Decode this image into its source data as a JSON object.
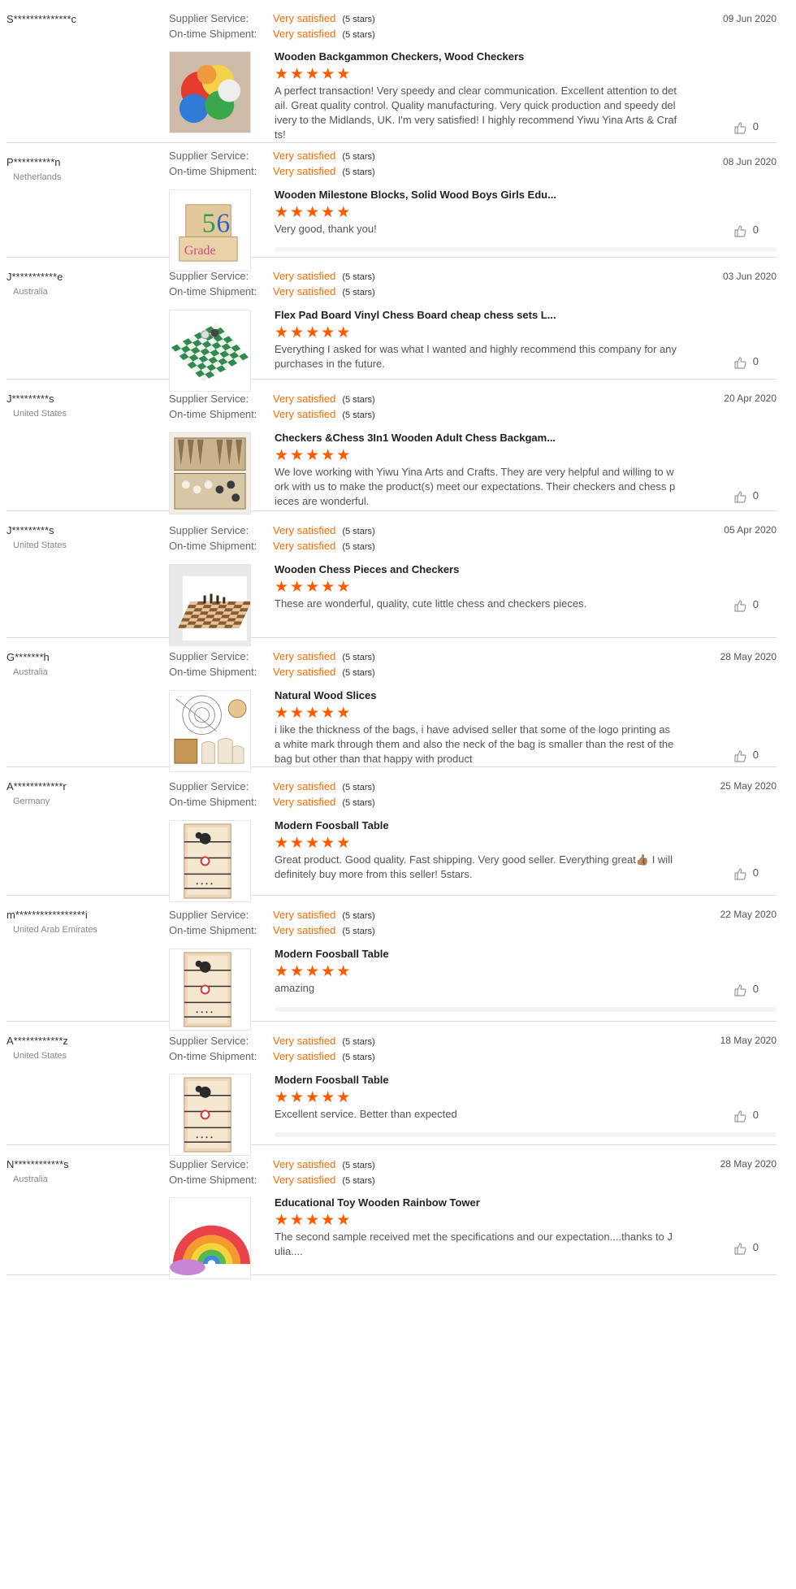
{
  "labels": {
    "supplier_service": "Supplier Service:",
    "ontime_shipment": "On-time Shipment:",
    "very_satisfied": "Very satisfied",
    "five_stars": "(5 stars)"
  },
  "colors": {
    "accent": "#ff6a00",
    "star": "#ff5a00"
  },
  "reviews": [
    {
      "buyer": "S**************c",
      "country": "",
      "date": "09 Jun 2020",
      "product": "Wooden Backgammon Checkers, Wood Checkers",
      "rating": 5,
      "comment": "A perfect transaction! Very speedy and clear communication. Excellent attention to detail. Great quality control. Quality manufacturing. Very quick production and speedy delivery to the Midlands, UK. I'm very satisfied! I highly recommend Yiwu Yina Arts & Crafts!",
      "likes": "0",
      "thumb_icon": "colored-checkers-image"
    },
    {
      "buyer": "P**********n",
      "country": "Netherlands",
      "date": "08 Jun 2020",
      "product": "Wooden Milestone Blocks, Solid Wood Boys Girls Edu...",
      "rating": 5,
      "comment": "Very good, thank you!",
      "likes": "0",
      "thumb_icon": "milestone-blocks-image"
    },
    {
      "buyer": "J***********e",
      "country": "Australia",
      "date": "03 Jun 2020",
      "product": "Flex Pad Board Vinyl Chess Board cheap chess sets L...",
      "rating": 5,
      "comment": "Everything I asked for was what I wanted and highly recommend this company for any purchases in the future.",
      "likes": "0",
      "thumb_icon": "vinyl-chess-board-image"
    },
    {
      "buyer": "J*********s",
      "country": "United States",
      "date": "20 Apr 2020",
      "product": "Checkers &Chess 3In1 Wooden Adult Chess Backgam...",
      "rating": 5,
      "comment": "We love working with Yiwu Yina Arts and Crafts.  They are very helpful and willing to work with us to make the product(s) meet our expectations.  Their checkers and chess pieces are wonderful.",
      "likes": "0",
      "thumb_icon": "chess-backgammon-box-image"
    },
    {
      "buyer": "J*********s",
      "country": "United States",
      "date": "05 Apr 2020",
      "product": "Wooden Chess Pieces and Checkers",
      "rating": 5,
      "comment": "These are wonderful, quality, cute little chess and checkers pieces.",
      "likes": "0",
      "thumb_icon": "wooden-chess-set-image"
    },
    {
      "buyer": "G*******h",
      "country": "Australia",
      "date": "28 May 2020",
      "product": "Natural Wood Slices",
      "rating": 5,
      "comment": "i like the thickness of the bags, i have advised seller that some of the logo printing as a white mark through them and also the neck of the bag is smaller than the rest of the bag but other than that happy with product",
      "likes": "0",
      "thumb_icon": "wood-slices-image"
    },
    {
      "buyer": "A************r",
      "country": "Germany",
      "date": "25 May 2020",
      "product": "Modern Foosball Table",
      "rating": 5,
      "comment": "Great product.  Good quality. Fast shipping. Very good seller.  Everything great👍🏽 I will definitely buy more from this seller! 5stars.",
      "likes": "0",
      "thumb_icon": "foosball-table-image"
    },
    {
      "buyer": "m*****************i",
      "country": "United Arab Emirates",
      "date": "22 May 2020",
      "product": "Modern Foosball Table",
      "rating": 5,
      "comment": "amazing",
      "likes": "0",
      "thumb_icon": "foosball-table-image"
    },
    {
      "buyer": "A************z",
      "country": "United States",
      "date": "18 May 2020",
      "product": "Modern Foosball Table",
      "rating": 5,
      "comment": "Excellent service. Better than expected",
      "likes": "0",
      "thumb_icon": "foosball-table-image"
    },
    {
      "buyer": "N************s",
      "country": "Australia",
      "date": "28 May 2020",
      "product": "Educational Toy Wooden Rainbow Tower",
      "rating": 5,
      "comment": "The second sample received met the specifications and our expectation....thanks to Julia....",
      "likes": "0",
      "thumb_icon": "rainbow-tower-image"
    }
  ]
}
